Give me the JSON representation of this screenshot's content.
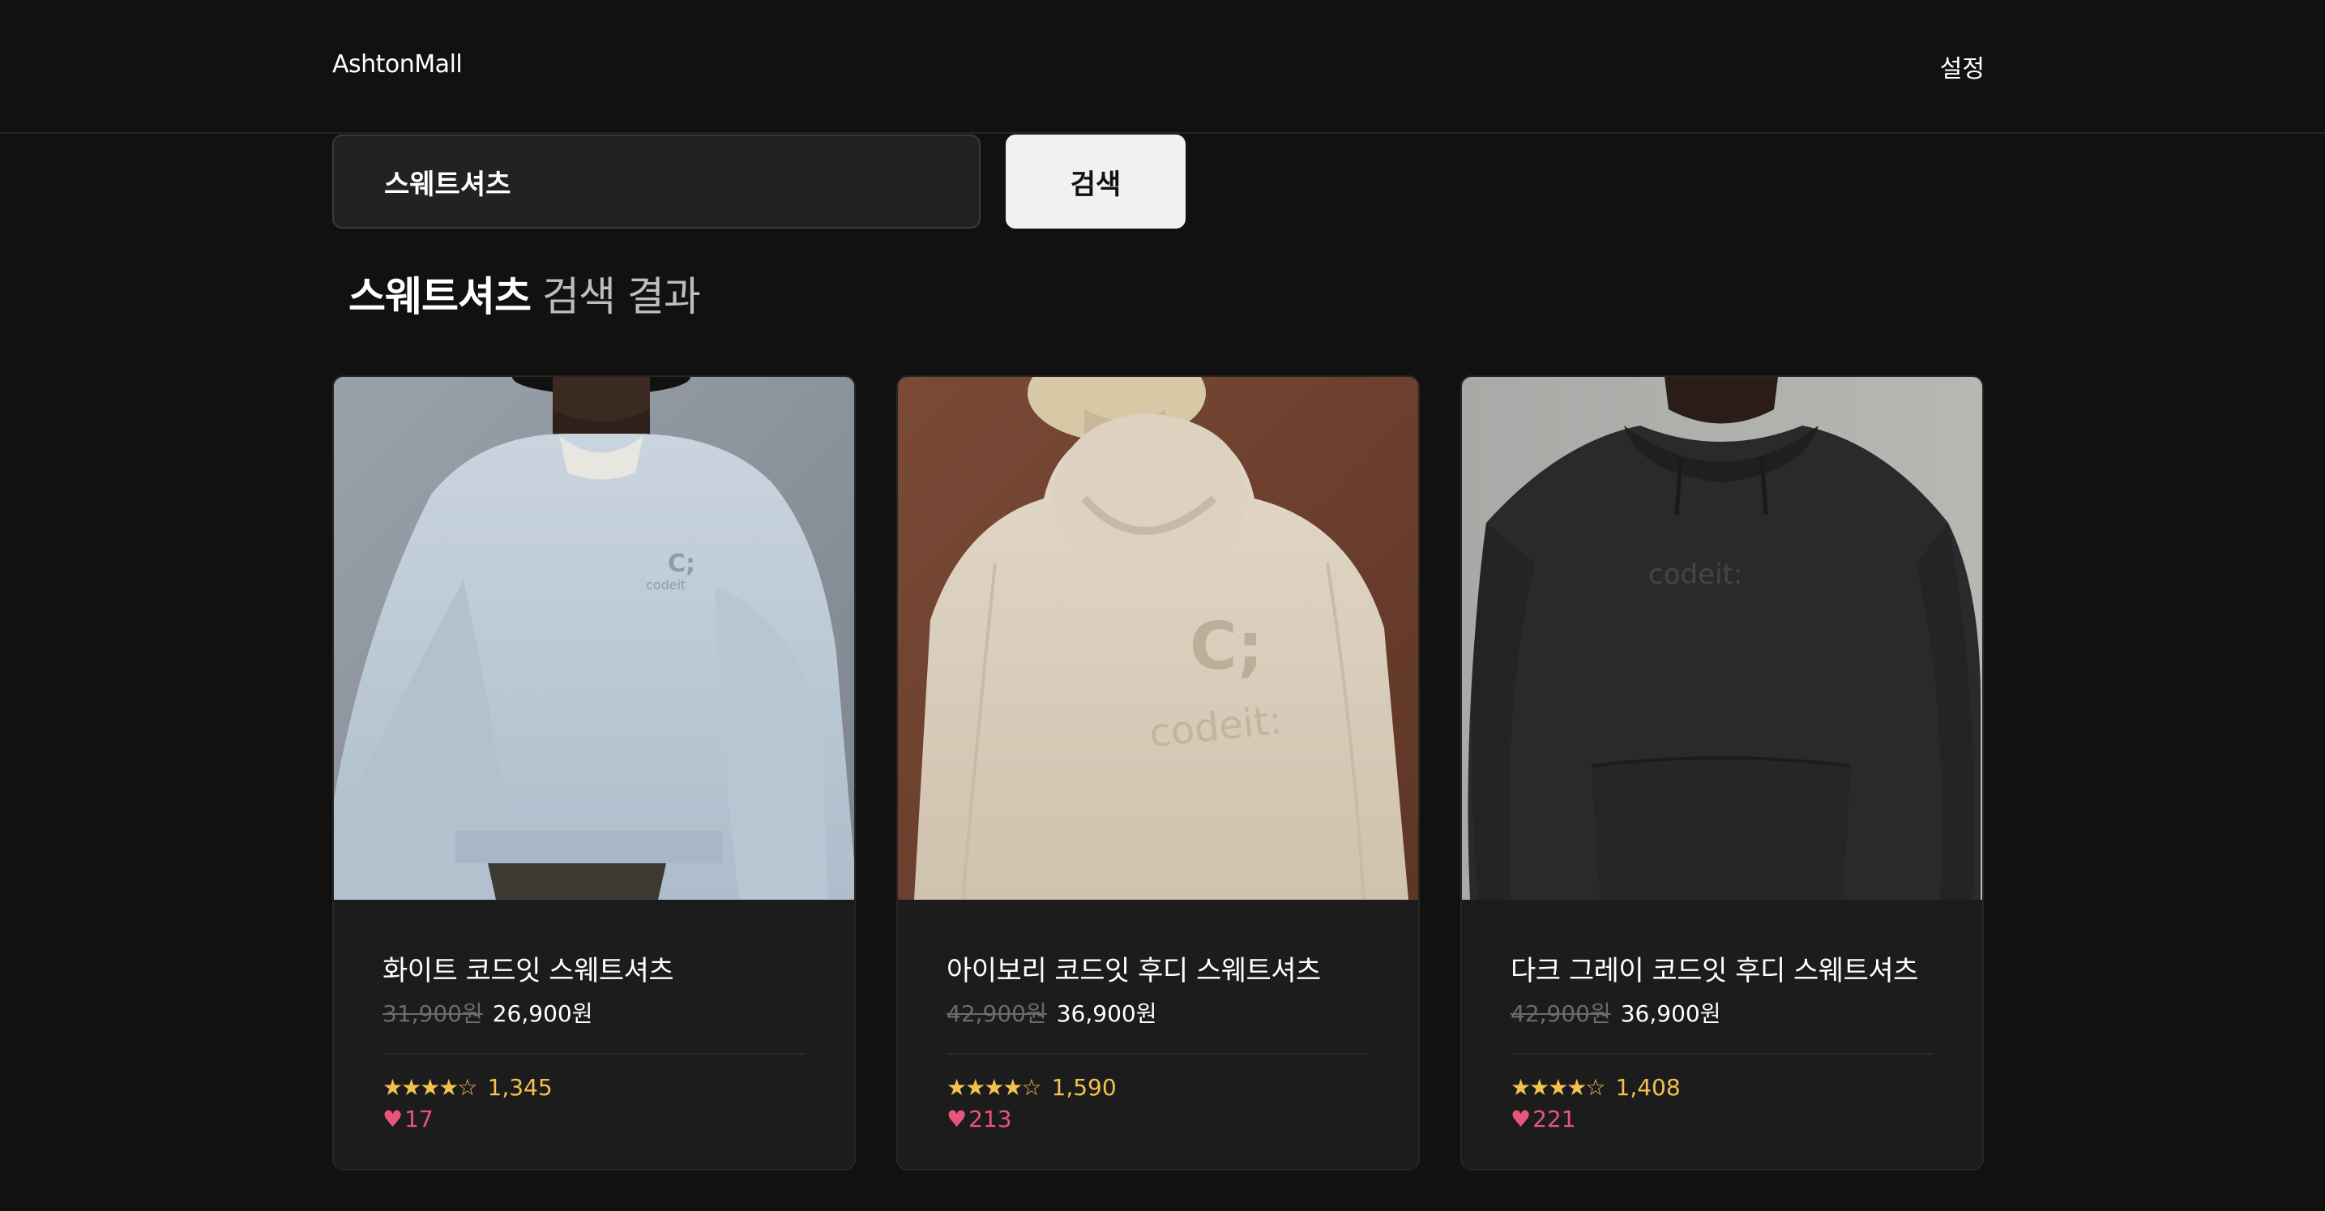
{
  "header": {
    "logo": "AshtonMall",
    "settings_label": "설정"
  },
  "search": {
    "value": "스웨트셔츠",
    "button_label": "검색"
  },
  "results": {
    "keyword": "스웨트셔츠",
    "suffix": "검색 결과"
  },
  "products": [
    {
      "name": "화이트 코드잇 스웨트셔츠",
      "original_price": "31,900원",
      "sale_price": "26,900원",
      "stars": "★★★★☆",
      "rating": 4,
      "review_count": "1,345",
      "likes": "17",
      "image_brand_text": "codeit",
      "image_logo_glyph": "C;"
    },
    {
      "name": "아이보리 코드잇 후디 스웨트셔츠",
      "original_price": "42,900원",
      "sale_price": "36,900원",
      "stars": "★★★★☆",
      "rating": 4,
      "review_count": "1,590",
      "likes": "213",
      "image_brand_text": "codeit:",
      "image_logo_glyph": "C;"
    },
    {
      "name": "다크 그레이 코드잇 후디 스웨트셔츠",
      "original_price": "42,900원",
      "sale_price": "36,900원",
      "stars": "★★★★☆",
      "rating": 4,
      "review_count": "1,408",
      "likes": "221",
      "image_brand_text": "codeit:"
    }
  ],
  "icons": {
    "heart": "heart-icon",
    "star": "star-icon"
  },
  "colors": {
    "background": "#111111",
    "card": "#1c1c1c",
    "star": "#f2c14e",
    "heart": "#e8557a",
    "button": "#f1f1f1"
  }
}
